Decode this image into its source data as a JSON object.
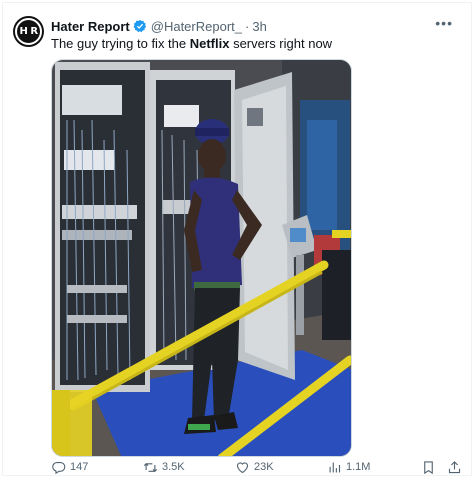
{
  "author": {
    "name": "Hater Report",
    "handle": "@HaterReport_",
    "separator": "·",
    "time": "3h",
    "avatar_text": "H R"
  },
  "tweet": {
    "text_before": "The guy trying to fix the ",
    "text_bold": "Netflix",
    "text_after": " servers right now"
  },
  "actions": {
    "replies": "147",
    "retweets": "3.5K",
    "likes": "23K",
    "views": "1.1M"
  },
  "icons": {
    "verified": "verified-badge-icon",
    "more": "more-options-icon",
    "reply": "reply-icon",
    "retweet": "retweet-icon",
    "like": "heart-icon",
    "views": "views-chart-icon",
    "bookmark": "bookmark-icon",
    "share": "share-icon"
  },
  "colors": {
    "verified": "#1d9bf0",
    "muted": "#536471",
    "text": "#0f1419"
  }
}
